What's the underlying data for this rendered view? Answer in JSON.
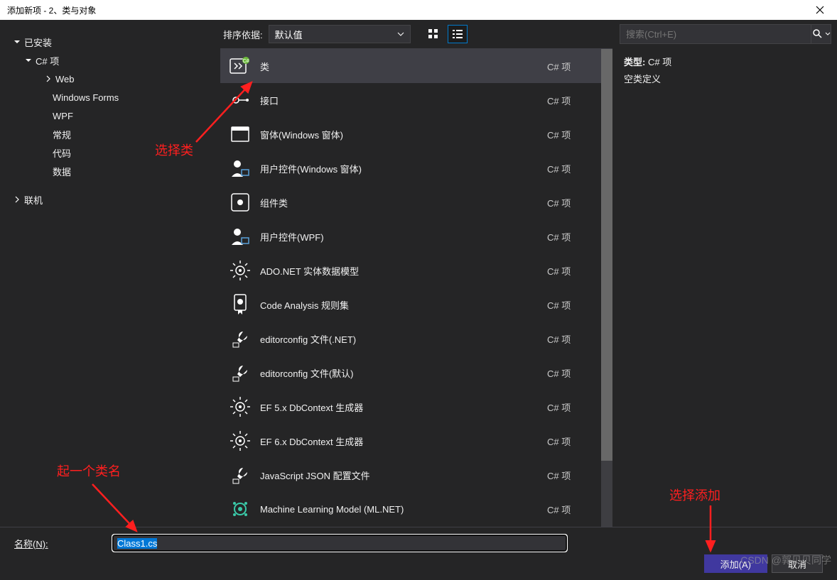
{
  "window": {
    "title": "添加新项 - 2、类与对象"
  },
  "left": {
    "installed": "已安装",
    "csharp": "C# 项",
    "items": [
      "Web",
      "Windows Forms",
      "WPF",
      "常规",
      "代码",
      "数据"
    ],
    "online": "联机"
  },
  "toolbar": {
    "sort_label": "排序依据:",
    "sort_value": "默认值"
  },
  "templates": [
    {
      "name": "类",
      "tag": "C# 项"
    },
    {
      "name": "接口",
      "tag": "C# 项"
    },
    {
      "name": "窗体(Windows 窗体)",
      "tag": "C# 项"
    },
    {
      "name": "用户控件(Windows 窗体)",
      "tag": "C# 项"
    },
    {
      "name": "组件类",
      "tag": "C# 项"
    },
    {
      "name": "用户控件(WPF)",
      "tag": "C# 项"
    },
    {
      "name": "ADO.NET 实体数据模型",
      "tag": "C# 项"
    },
    {
      "name": "Code Analysis 规则集",
      "tag": "C# 项"
    },
    {
      "name": "editorconfig 文件(.NET)",
      "tag": "C# 项"
    },
    {
      "name": "editorconfig 文件(默认)",
      "tag": "C# 项"
    },
    {
      "name": "EF 5.x DbContext 生成器",
      "tag": "C# 项"
    },
    {
      "name": "EF 6.x DbContext 生成器",
      "tag": "C# 项"
    },
    {
      "name": "JavaScript JSON 配置文件",
      "tag": "C# 项"
    },
    {
      "name": "Machine Learning Model (ML.NET)",
      "tag": "C# 项"
    }
  ],
  "right": {
    "search_placeholder": "搜索(Ctrl+E)",
    "type_label": "类型:",
    "type_value": "C# 项",
    "desc": "空类定义"
  },
  "bottom": {
    "name_label": "名称(N):",
    "name_value": "Class1.cs",
    "add_btn": "添加(A)",
    "cancel_btn": "取消"
  },
  "annotations": {
    "a1": "选择类",
    "a2": "起一个类名",
    "a3": "选择添加"
  },
  "watermark": "CSDN @郭贝贝同学"
}
